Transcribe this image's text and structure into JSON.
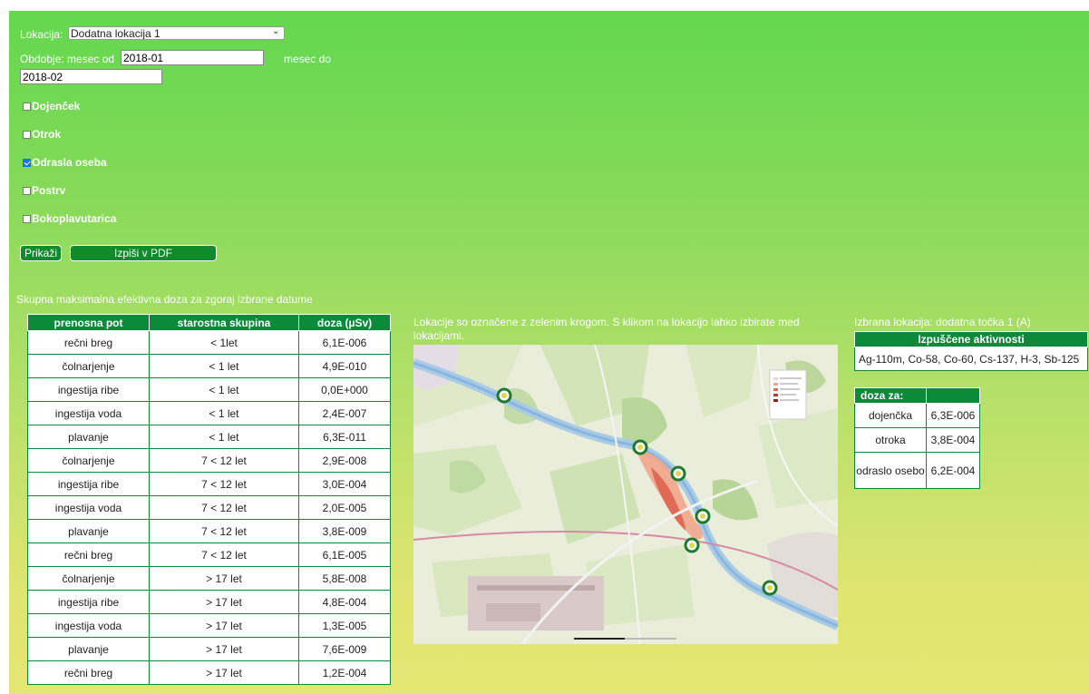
{
  "form": {
    "location_label": "Lokacija:",
    "location_value": "Dodatna lokacija 1",
    "period_label": "Obdobje: mesec od",
    "from_value": "2018-01",
    "to_label": "mesec do",
    "to_value": "2018-02"
  },
  "checkboxes": [
    {
      "label": "Dojenček",
      "checked": false
    },
    {
      "label": "Otrok",
      "checked": false
    },
    {
      "label": "Odrasla oseba",
      "checked": true
    },
    {
      "label": "Postrv",
      "checked": false
    },
    {
      "label": "Bokoplavutarica",
      "checked": false
    }
  ],
  "buttons": {
    "show": "Prikaži",
    "pdf": "Izpiši v PDF"
  },
  "dose_table": {
    "caption": "Skupna maksimalna efektivna doza za zgoraj izbrane datume",
    "headers": [
      "prenosna pot",
      "starostna skupina",
      "doza (µSv)"
    ],
    "rows": [
      [
        "rečni breg",
        "< 1let",
        "6,1E-006"
      ],
      [
        "čolnarjenje",
        "< 1 let",
        "4,9E-010"
      ],
      [
        "ingestija ribe",
        "< 1 let",
        "0,0E+000"
      ],
      [
        "ingestija voda",
        "< 1 let",
        "2,4E-007"
      ],
      [
        "plavanje",
        "< 1 let",
        "6,3E-011"
      ],
      [
        "čolnarjenje",
        "7 < 12 let",
        "2,9E-008"
      ],
      [
        "ingestija ribe",
        "7 < 12 let",
        "3,0E-004"
      ],
      [
        "ingestija voda",
        "7 < 12 let",
        "2,0E-005"
      ],
      [
        "plavanje",
        "7 < 12 let",
        "3,8E-009"
      ],
      [
        "rečni breg",
        "7 < 12 let",
        "6,1E-005"
      ],
      [
        "čolnarjenje",
        "> 17 let",
        "5,8E-008"
      ],
      [
        "ingestija ribe",
        "> 17 let",
        "4,8E-004"
      ],
      [
        "ingestija voda",
        "> 17 let",
        "1,3E-005"
      ],
      [
        "plavanje",
        "> 17 let",
        "7,6E-009"
      ],
      [
        "rečni breg",
        "> 17 let",
        "1,2E-004"
      ]
    ]
  },
  "map": {
    "caption": "Lokacije so označene z zelenim krogom. S klikom na lokacijo lahko izbirate med lokacijami."
  },
  "selected": {
    "caption": "Izbrana lokacija: dodatna točka 1 (A)",
    "activities_header": "Izpuščene aktivnosti",
    "activities": "Ag-110m, Co-58, Co-60, Cs-137, H-3, Sb-125",
    "dose_header": "doza za:",
    "doses": [
      {
        "who": "dojenčka",
        "value": "6,3E-006"
      },
      {
        "who": "otroka",
        "value": "3,8E-004"
      },
      {
        "who": "odraslo osebo",
        "value": "6,2E-004"
      }
    ]
  },
  "colors": {
    "header_green": "#0b8a3a",
    "button_green": "#118a2c",
    "marker": "#1f7a2e"
  }
}
